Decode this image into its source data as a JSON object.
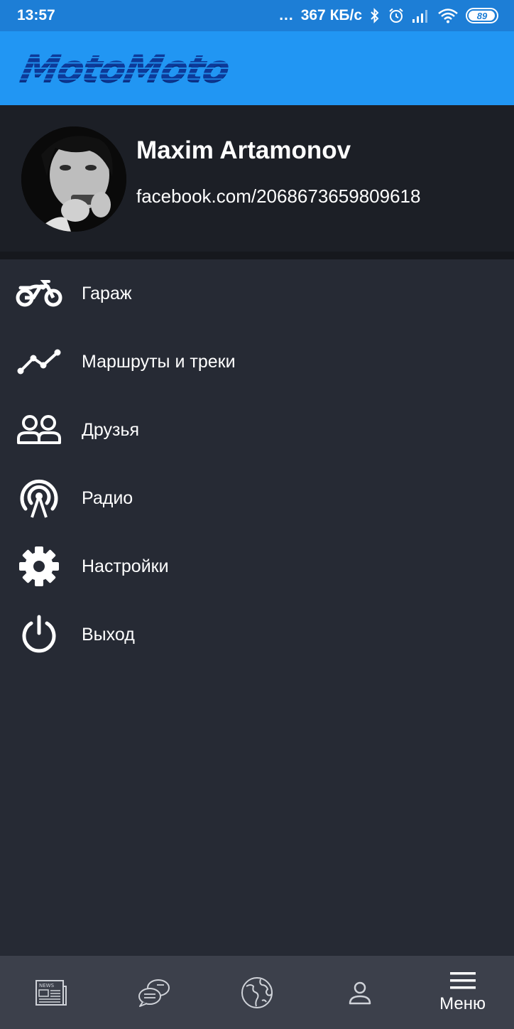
{
  "status_bar": {
    "time": "13:57",
    "dots": "...",
    "speed": "367 КБ/с",
    "battery": "89"
  },
  "app_bar": {
    "logo_text": "MotoMoto"
  },
  "profile": {
    "name": "Maxim Artamonov",
    "link": "facebook.com/2068673659809618"
  },
  "menu": {
    "items": [
      {
        "label": "Гараж",
        "icon": "motorcycle-icon"
      },
      {
        "label": "Маршруты и треки",
        "icon": "route-chart-icon"
      },
      {
        "label": "Друзья",
        "icon": "friends-icon"
      },
      {
        "label": "Радио",
        "icon": "radio-tower-icon"
      },
      {
        "label": "Настройки",
        "icon": "gear-icon"
      },
      {
        "label": "Выход",
        "icon": "power-icon"
      }
    ]
  },
  "bottom_nav": {
    "items": [
      {
        "icon": "news-icon",
        "label": ""
      },
      {
        "icon": "chat-icon",
        "label": ""
      },
      {
        "icon": "globe-icon",
        "label": ""
      },
      {
        "icon": "profile-icon",
        "label": ""
      },
      {
        "icon": "hamburger-menu-icon",
        "label": "Меню"
      }
    ]
  },
  "colors": {
    "status_bar": "#1d7ed6",
    "app_bar": "#2196f3",
    "profile_bg": "#1c1f26",
    "drawer_bg": "#262a34",
    "bottom_nav_bg": "#3c404b"
  }
}
